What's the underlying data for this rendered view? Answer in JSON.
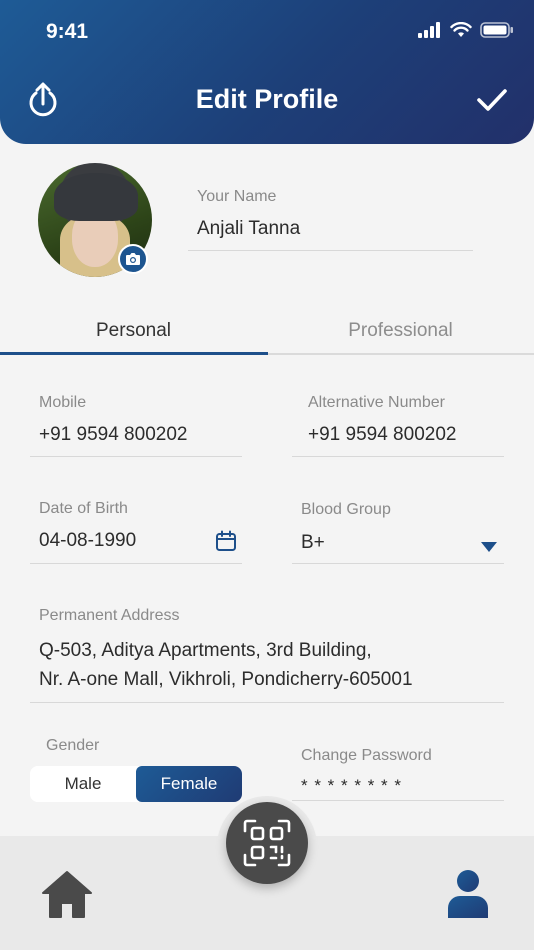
{
  "status_bar": {
    "time": "9:41"
  },
  "header": {
    "title": "Edit Profile",
    "left_icon": "share-icon",
    "right_icon": "check-icon"
  },
  "profile": {
    "name_label": "Your Name",
    "name_value": "Anjali Tanna",
    "camera_icon": "camera-icon"
  },
  "tabs": [
    {
      "label": "Personal",
      "active": true
    },
    {
      "label": "Professional",
      "active": false
    }
  ],
  "form": {
    "mobile": {
      "label": "Mobile",
      "value": "+91 9594 800202"
    },
    "alt_number": {
      "label": "Alternative Number",
      "value": "+91 9594 800202"
    },
    "dob": {
      "label": "Date of Birth",
      "value": "04-08-1990",
      "icon": "calendar-icon"
    },
    "blood_group": {
      "label": "Blood Group",
      "value": "B+",
      "icon": "dropdown-arrow-icon"
    },
    "address": {
      "label": "Permanent Address",
      "line1": "Q-503, Aditya Apartments, 3rd Building,",
      "line2": "Nr. A-one Mall, Vikhroli, Pondicherry-605001"
    },
    "gender": {
      "label": "Gender",
      "options": [
        "Male",
        "Female"
      ],
      "selected": "Female"
    },
    "password": {
      "label": "Change Password",
      "value": "* * * * * * * *"
    }
  },
  "bottom_nav": {
    "home_icon": "home-icon",
    "qr_icon": "qr-code-icon",
    "profile_icon": "user-icon"
  },
  "colors": {
    "primary": "#1d4f8a",
    "header_end": "#22306a",
    "bottom_bar": "#e9e9e9"
  }
}
